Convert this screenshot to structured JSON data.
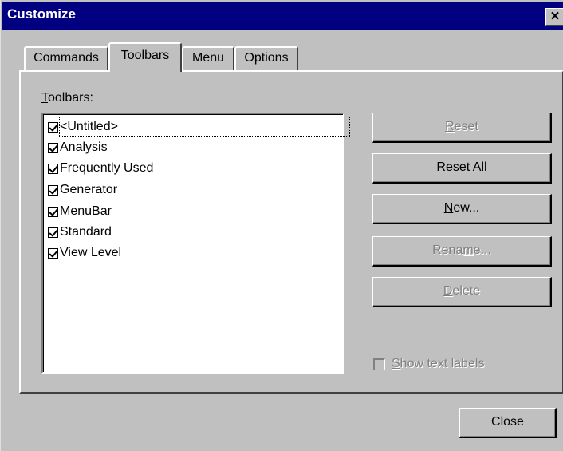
{
  "window": {
    "title": "Customize",
    "close_glyph": "✕"
  },
  "tabs": [
    {
      "label": "Commands",
      "active": false
    },
    {
      "label": "Toolbars",
      "active": true
    },
    {
      "label": "Menu",
      "active": false
    },
    {
      "label": "Options",
      "active": false
    }
  ],
  "toolbars_panel": {
    "list_label_accel": "T",
    "list_label_rest": "oolbars:",
    "items": [
      {
        "label": "<Untitled>",
        "checked": true
      },
      {
        "label": "Analysis",
        "checked": true
      },
      {
        "label": "Frequently Used",
        "checked": true
      },
      {
        "label": "Generator",
        "checked": true
      },
      {
        "label": "MenuBar",
        "checked": true
      },
      {
        "label": "Standard",
        "checked": true
      },
      {
        "label": "View Level",
        "checked": true
      }
    ],
    "buttons": {
      "reset_accel": "R",
      "reset_rest": "eset",
      "reset_all_pre": "Reset ",
      "reset_all_accel": "A",
      "reset_all_rest": "ll",
      "new_accel": "N",
      "new_rest": "ew...",
      "rename_pre": "Rena",
      "rename_accel": "m",
      "rename_rest": "e...",
      "delete_accel": "D",
      "delete_rest": "elete"
    },
    "show_text_labels_accel": "S",
    "show_text_labels_rest": "how text labels"
  },
  "footer": {
    "close_label": "Close"
  },
  "colors": {
    "title_bar": "#000080",
    "face": "#c0c0c0",
    "disabled_text": "#808080"
  }
}
